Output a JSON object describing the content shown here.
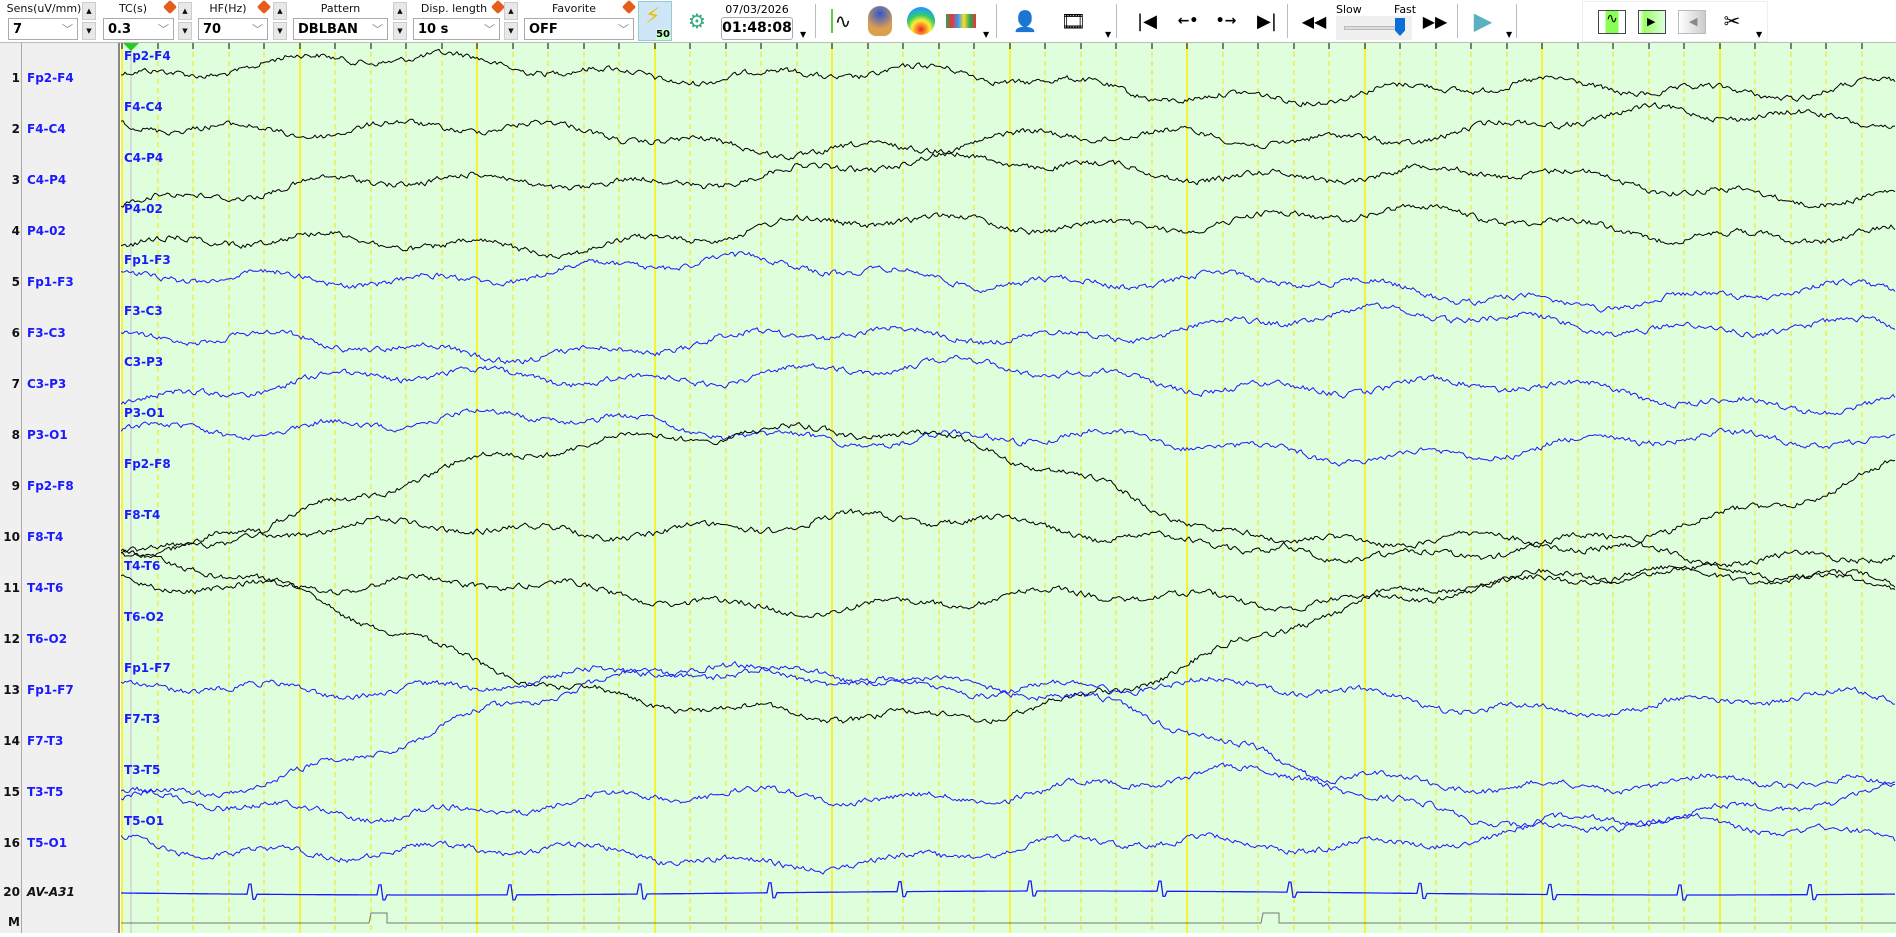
{
  "toolbar": {
    "sens": {
      "label": "Sens(uV/mm)",
      "value": "7"
    },
    "tc": {
      "label": "TC(s)",
      "value": "0.3"
    },
    "hf": {
      "label": "HF(Hz)",
      "value": "70"
    },
    "pattern": {
      "label": "Pattern",
      "value": "DBLBAN"
    },
    "disp_length": {
      "label": "Disp. length",
      "value": "10 s"
    },
    "favorite": {
      "label": "Favorite",
      "value": "OFF"
    },
    "filter_badge": "50",
    "date": "07/03/2026",
    "time": "01:48:08",
    "speed": {
      "slow_label": "Slow",
      "fast_label": "Fast",
      "value": 0.92
    }
  },
  "channels": [
    {
      "num": "1",
      "name": "Fp2-F4",
      "color": "#000000"
    },
    {
      "num": "2",
      "name": "F4-C4",
      "color": "#000000"
    },
    {
      "num": "3",
      "name": "C4-P4",
      "color": "#000000"
    },
    {
      "num": "4",
      "name": "P4-02",
      "color": "#000000"
    },
    {
      "num": "5",
      "name": "Fp1-F3",
      "color": "#1a1aff"
    },
    {
      "num": "6",
      "name": "F3-C3",
      "color": "#1a1aff"
    },
    {
      "num": "7",
      "name": "C3-P3",
      "color": "#1a1aff"
    },
    {
      "num": "8",
      "name": "P3-O1",
      "color": "#1a1aff"
    },
    {
      "num": "9",
      "name": "Fp2-F8",
      "color": "#000000"
    },
    {
      "num": "10",
      "name": "F8-T4",
      "color": "#000000"
    },
    {
      "num": "11",
      "name": "T4-T6",
      "color": "#000000"
    },
    {
      "num": "12",
      "name": "T6-O2",
      "color": "#000000"
    },
    {
      "num": "13",
      "name": "Fp1-F7",
      "color": "#1a1aff"
    },
    {
      "num": "14",
      "name": "F7-T3",
      "color": "#1a1aff"
    },
    {
      "num": "15",
      "name": "T3-T5",
      "color": "#1a1aff"
    },
    {
      "num": "16",
      "name": "T5-O1",
      "color": "#1a1aff"
    }
  ],
  "ecg": {
    "num": "20",
    "name": "AV-A31",
    "color": "#1a1aff"
  },
  "marker": {
    "num": "M"
  },
  "colors": {
    "background": "#dfffdc",
    "grid_second": "#ffee00",
    "grid_sub": "#f2e600"
  }
}
